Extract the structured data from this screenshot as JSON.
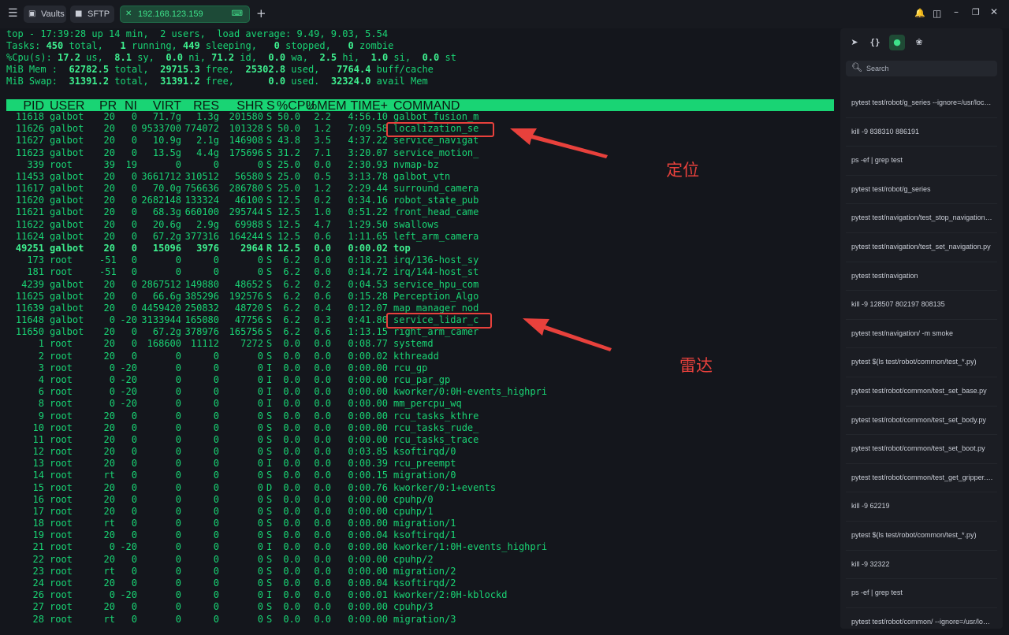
{
  "tabs": [
    {
      "label": "Vaults",
      "icon": "vault-icon",
      "active": false
    },
    {
      "label": "SFTP",
      "icon": "folder-icon",
      "active": false
    },
    {
      "label": "192.168.123.159",
      "icon": "close-icon",
      "active": true
    }
  ],
  "top_summary": {
    "line1": "top - 17:39:28 up 14 min,  2 users,  load average: 9.49, 9.03, 5.54",
    "tasks_label": "Tasks: ",
    "tasks_total": "450",
    "tasks_total_label": " total,   ",
    "tasks_running": "1",
    "tasks_running_label": " running, ",
    "tasks_sleeping": "449",
    "tasks_sleeping_label": " sleeping,   ",
    "tasks_stopped": "0",
    "tasks_stopped_label": " stopped,   ",
    "tasks_zombie": "0",
    "tasks_zombie_label": " zombie",
    "cpu_label": "%Cpu(s): ",
    "cpu_us": "17.2",
    "cpu_us_label": " us,  ",
    "cpu_sy": "8.1",
    "cpu_sy_label": " sy,  ",
    "cpu_ni": "0.0",
    "cpu_ni_label": " ni, ",
    "cpu_id": "71.2",
    "cpu_id_label": " id,  ",
    "cpu_wa": "0.0",
    "cpu_wa_label": " wa,  ",
    "cpu_hi": "2.5",
    "cpu_hi_label": " hi,  ",
    "cpu_si": "1.0",
    "cpu_si_label": " si,  ",
    "cpu_st": "0.0",
    "cpu_st_label": " st",
    "mem_label": "MiB Mem :  ",
    "mem_total": "62782.5",
    "mem_total_label": " total,  ",
    "mem_free": "29715.3",
    "mem_free_label": " free,  ",
    "mem_used": "25302.8",
    "mem_used_label": " used,   ",
    "mem_buff": "7764.4",
    "mem_buff_label": " buff/cache",
    "swap_label": "MiB Swap:  ",
    "swap_total": "31391.2",
    "swap_total_label": " total,  ",
    "swap_free": "31391.2",
    "swap_free_label": " free,      ",
    "swap_used": "0.0",
    "swap_used_label": " used.  ",
    "swap_avail": "32324.0",
    "swap_avail_label": " avail Mem"
  },
  "columns": [
    "PID",
    "USER",
    "PR",
    "NI",
    "VIRT",
    "RES",
    "SHR",
    "S",
    "%CPU",
    "%MEM",
    "TIME+",
    "COMMAND"
  ],
  "processes": [
    [
      "11618",
      "galbot",
      "20",
      "0",
      "71.7g",
      "1.3g",
      "201580",
      "S",
      "50.0",
      "2.2",
      "4:56.10",
      "galbot_fusion_m"
    ],
    [
      "11626",
      "galbot",
      "20",
      "0",
      "9533700",
      "774072",
      "101328",
      "S",
      "50.0",
      "1.2",
      "7:09.58",
      "localization_se"
    ],
    [
      "11627",
      "galbot",
      "20",
      "0",
      "10.9g",
      "2.1g",
      "146908",
      "S",
      "43.8",
      "3.5",
      "4:37.22",
      "service_navigat"
    ],
    [
      "11623",
      "galbot",
      "20",
      "0",
      "13.5g",
      "4.4g",
      "175696",
      "S",
      "31.2",
      "7.1",
      "3:20.07",
      "service_motion_"
    ],
    [
      "339",
      "root",
      "39",
      "19",
      "0",
      "0",
      "0",
      "S",
      "25.0",
      "0.0",
      "2:30.93",
      "nvmap-bz"
    ],
    [
      "11453",
      "galbot",
      "20",
      "0",
      "3661712",
      "310512",
      "56580",
      "S",
      "25.0",
      "0.5",
      "3:13.78",
      "galbot_vtn"
    ],
    [
      "11617",
      "galbot",
      "20",
      "0",
      "70.0g",
      "756636",
      "286780",
      "S",
      "25.0",
      "1.2",
      "2:29.44",
      "surround_camera"
    ],
    [
      "11620",
      "galbot",
      "20",
      "0",
      "2682148",
      "133324",
      "46100",
      "S",
      "12.5",
      "0.2",
      "0:34.16",
      "robot_state_pub"
    ],
    [
      "11621",
      "galbot",
      "20",
      "0",
      "68.3g",
      "660100",
      "295744",
      "S",
      "12.5",
      "1.0",
      "0:51.22",
      "front_head_came"
    ],
    [
      "11622",
      "galbot",
      "20",
      "0",
      "20.6g",
      "2.9g",
      "69988",
      "S",
      "12.5",
      "4.7",
      "1:29.50",
      "swallows"
    ],
    [
      "11624",
      "galbot",
      "20",
      "0",
      "67.2g",
      "377316",
      "164244",
      "S",
      "12.5",
      "0.6",
      "1:11.65",
      "left_arm_camera"
    ],
    [
      "49251",
      "galbot",
      "20",
      "0",
      "15096",
      "3976",
      "2964",
      "R",
      "12.5",
      "0.0",
      "0:00.02",
      "top"
    ],
    [
      "173",
      "root",
      "-51",
      "0",
      "0",
      "0",
      "0",
      "S",
      "6.2",
      "0.0",
      "0:18.21",
      "irq/136-host_sy"
    ],
    [
      "181",
      "root",
      "-51",
      "0",
      "0",
      "0",
      "0",
      "S",
      "6.2",
      "0.0",
      "0:14.72",
      "irq/144-host_st"
    ],
    [
      "4239",
      "galbot",
      "20",
      "0",
      "2867512",
      "149880",
      "48652",
      "S",
      "6.2",
      "0.2",
      "0:04.53",
      "service_hpu_com"
    ],
    [
      "11625",
      "galbot",
      "20",
      "0",
      "66.6g",
      "385296",
      "192576",
      "S",
      "6.2",
      "0.6",
      "0:15.28",
      "Perception_Algo"
    ],
    [
      "11639",
      "galbot",
      "20",
      "0",
      "4459420",
      "250832",
      "48720",
      "S",
      "6.2",
      "0.4",
      "0:12.07",
      "map_manager_nod"
    ],
    [
      "11648",
      "galbot",
      "0",
      "-20",
      "3133944",
      "165080",
      "47756",
      "S",
      "6.2",
      "0.3",
      "0:41.80",
      "service_lidar_c"
    ],
    [
      "11650",
      "galbot",
      "20",
      "0",
      "67.2g",
      "378976",
      "165756",
      "S",
      "6.2",
      "0.6",
      "1:13.15",
      "right_arm_camer"
    ],
    [
      "1",
      "root",
      "20",
      "0",
      "168600",
      "11112",
      "7272",
      "S",
      "0.0",
      "0.0",
      "0:08.77",
      "systemd"
    ],
    [
      "2",
      "root",
      "20",
      "0",
      "0",
      "0",
      "0",
      "S",
      "0.0",
      "0.0",
      "0:00.02",
      "kthreadd"
    ],
    [
      "3",
      "root",
      "0",
      "-20",
      "0",
      "0",
      "0",
      "I",
      "0.0",
      "0.0",
      "0:00.00",
      "rcu_gp"
    ],
    [
      "4",
      "root",
      "0",
      "-20",
      "0",
      "0",
      "0",
      "I",
      "0.0",
      "0.0",
      "0:00.00",
      "rcu_par_gp"
    ],
    [
      "6",
      "root",
      "0",
      "-20",
      "0",
      "0",
      "0",
      "I",
      "0.0",
      "0.0",
      "0:00.00",
      "kworker/0:0H-events_highpri"
    ],
    [
      "8",
      "root",
      "0",
      "-20",
      "0",
      "0",
      "0",
      "I",
      "0.0",
      "0.0",
      "0:00.00",
      "mm_percpu_wq"
    ],
    [
      "9",
      "root",
      "20",
      "0",
      "0",
      "0",
      "0",
      "S",
      "0.0",
      "0.0",
      "0:00.00",
      "rcu_tasks_kthre"
    ],
    [
      "10",
      "root",
      "20",
      "0",
      "0",
      "0",
      "0",
      "S",
      "0.0",
      "0.0",
      "0:00.00",
      "rcu_tasks_rude_"
    ],
    [
      "11",
      "root",
      "20",
      "0",
      "0",
      "0",
      "0",
      "S",
      "0.0",
      "0.0",
      "0:00.00",
      "rcu_tasks_trace"
    ],
    [
      "12",
      "root",
      "20",
      "0",
      "0",
      "0",
      "0",
      "S",
      "0.0",
      "0.0",
      "0:03.85",
      "ksoftirqd/0"
    ],
    [
      "13",
      "root",
      "20",
      "0",
      "0",
      "0",
      "0",
      "I",
      "0.0",
      "0.0",
      "0:00.39",
      "rcu_preempt"
    ],
    [
      "14",
      "root",
      "rt",
      "0",
      "0",
      "0",
      "0",
      "S",
      "0.0",
      "0.0",
      "0:00.15",
      "migration/0"
    ],
    [
      "15",
      "root",
      "20",
      "0",
      "0",
      "0",
      "0",
      "D",
      "0.0",
      "0.0",
      "0:00.76",
      "kworker/0:1+events"
    ],
    [
      "16",
      "root",
      "20",
      "0",
      "0",
      "0",
      "0",
      "S",
      "0.0",
      "0.0",
      "0:00.00",
      "cpuhp/0"
    ],
    [
      "17",
      "root",
      "20",
      "0",
      "0",
      "0",
      "0",
      "S",
      "0.0",
      "0.0",
      "0:00.00",
      "cpuhp/1"
    ],
    [
      "18",
      "root",
      "rt",
      "0",
      "0",
      "0",
      "0",
      "S",
      "0.0",
      "0.0",
      "0:00.00",
      "migration/1"
    ],
    [
      "19",
      "root",
      "20",
      "0",
      "0",
      "0",
      "0",
      "S",
      "0.0",
      "0.0",
      "0:00.04",
      "ksoftirqd/1"
    ],
    [
      "21",
      "root",
      "0",
      "-20",
      "0",
      "0",
      "0",
      "I",
      "0.0",
      "0.0",
      "0:00.00",
      "kworker/1:0H-events_highpri"
    ],
    [
      "22",
      "root",
      "20",
      "0",
      "0",
      "0",
      "0",
      "S",
      "0.0",
      "0.0",
      "0:00.00",
      "cpuhp/2"
    ],
    [
      "23",
      "root",
      "rt",
      "0",
      "0",
      "0",
      "0",
      "S",
      "0.0",
      "0.0",
      "0:00.00",
      "migration/2"
    ],
    [
      "24",
      "root",
      "20",
      "0",
      "0",
      "0",
      "0",
      "S",
      "0.0",
      "0.0",
      "0:00.04",
      "ksoftirqd/2"
    ],
    [
      "26",
      "root",
      "0",
      "-20",
      "0",
      "0",
      "0",
      "I",
      "0.0",
      "0.0",
      "0:00.01",
      "kworker/2:0H-kblockd"
    ],
    [
      "27",
      "root",
      "20",
      "0",
      "0",
      "0",
      "0",
      "S",
      "0.0",
      "0.0",
      "0:00.00",
      "cpuhp/3"
    ],
    [
      "28",
      "root",
      "rt",
      "0",
      "0",
      "0",
      "0",
      "S",
      "0.0",
      "0.0",
      "0:00.00",
      "migration/3"
    ]
  ],
  "highlighted_pid": "49251",
  "annotations": [
    {
      "label": "定位",
      "target_pid": "11626"
    },
    {
      "label": "雷达",
      "target_pid": "11648"
    }
  ],
  "sidebar": {
    "search_placeholder": "Search",
    "snippets": [
      "pytest test/robot/g_series --ignore=/usr/local/lib",
      "kill -9 838310 886191",
      "ps -ef | grep test",
      "pytest test/robot/g_series",
      "pytest test/navigation/test_stop_navigation.py",
      "pytest test/navigation/test_set_navigation.py",
      "pytest test/navigation",
      "kill -9 128507 802197 808135",
      "pytest test/navigation/ -m smoke",
      "pytest $(ls test/robot/common/test_*.py)",
      "pytest test/robot/common/test_set_base.py",
      "pytest test/robot/common/test_set_body.py",
      "pytest test/robot/common/test_set_boot.py",
      "pytest test/robot/common/test_get_gripper.py",
      "kill -9 62219",
      "pytest $(ls test/robot/common/test_*.py)",
      "kill -9 32322",
      "ps -ef | grep test",
      "pytest test/robot/common/ --ignore=/usr/local/lib"
    ]
  },
  "colors": {
    "terminal_fg": "#19d474",
    "terminal_bg": "#14161c",
    "header_bg": "#19d474",
    "annotation": "#e8413c",
    "active_tab": "#1d4a37"
  }
}
